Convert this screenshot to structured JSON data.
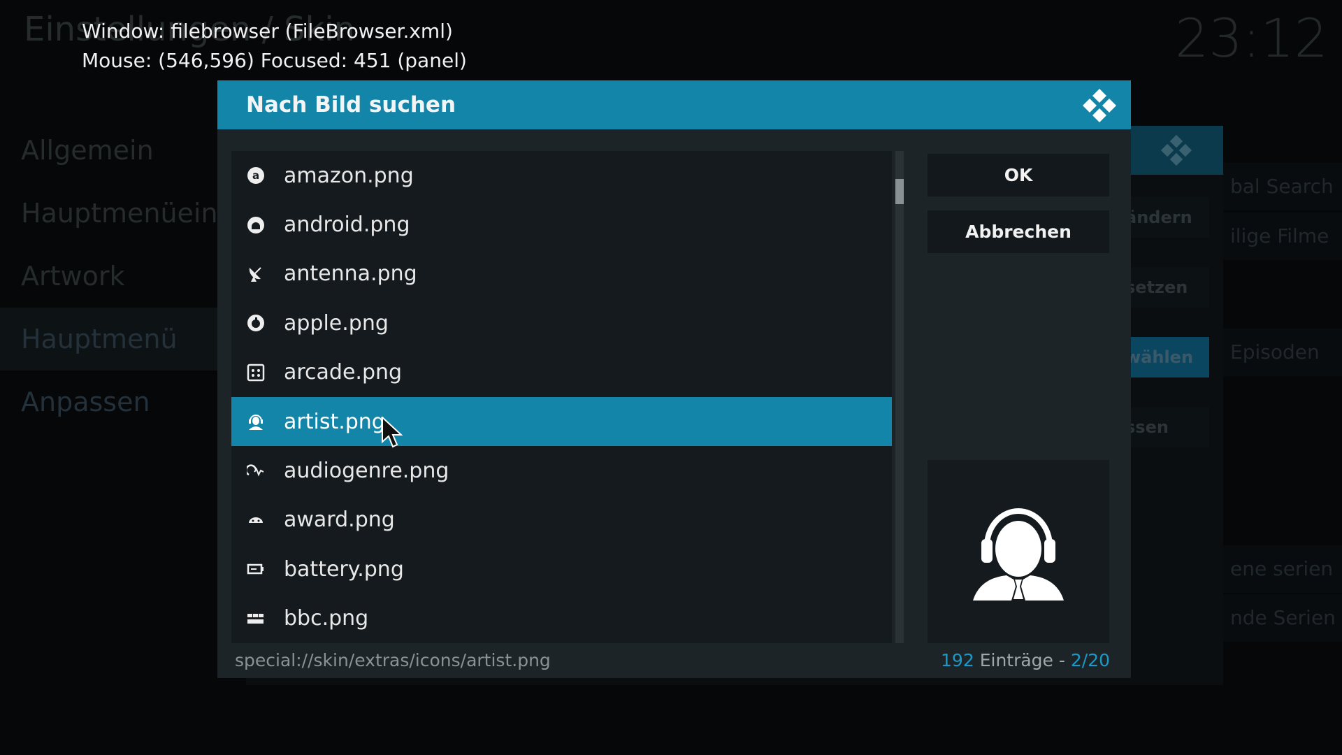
{
  "background": {
    "title": "Einstellungen / Skin",
    "clock": "23:12",
    "menu": [
      {
        "label": "Allgemein"
      },
      {
        "label": "Hauptmenüeinträge"
      },
      {
        "label": "Artwork"
      },
      {
        "label": "Hauptmenü Anpassen"
      }
    ],
    "buttons": [
      {
        "label": "ändern"
      },
      {
        "label": "setzen"
      },
      {
        "label": "wählen"
      },
      {
        "label": "ssen"
      }
    ],
    "right_items": [
      {
        "label": "bal Search"
      },
      {
        "label": "ilige Filme"
      },
      {
        "label": "Episoden"
      },
      {
        "label": "ene serien"
      },
      {
        "label": "nde Serien"
      }
    ]
  },
  "debug": {
    "window_line": "Window: filebrowser (FileBrowser.xml)",
    "mouse_line": "Mouse: (546,596)  Focused: 451 (panel)"
  },
  "dialog": {
    "title": "Nach Bild suchen",
    "ok_label": "OK",
    "cancel_label": "Abbrechen",
    "files": [
      {
        "name": "amazon.png",
        "icon": "amazon-icon"
      },
      {
        "name": "android.png",
        "icon": "android-icon"
      },
      {
        "name": "antenna.png",
        "icon": "antenna-icon"
      },
      {
        "name": "apple.png",
        "icon": "apple-icon"
      },
      {
        "name": "arcade.png",
        "icon": "arcade-icon"
      },
      {
        "name": "artist.png",
        "icon": "artist-icon",
        "selected": true
      },
      {
        "name": "audiogenre.png",
        "icon": "audiogenre-icon"
      },
      {
        "name": "award.png",
        "icon": "award-icon"
      },
      {
        "name": "battery.png",
        "icon": "battery-icon"
      },
      {
        "name": "bbc.png",
        "icon": "bbc-iplayer-icon"
      }
    ],
    "path": "special://skin/extras/icons/artist.png",
    "count": "192",
    "count_label": " Einträge - ",
    "page": "2/20",
    "preview_icon": "artist-headphones-icon",
    "scroll_position": 0.06
  },
  "colors": {
    "accent": "#1285a8",
    "dialog_bg": "#1c2428",
    "list_bg": "#141a1d",
    "count_accent": "#1c9ac7"
  }
}
